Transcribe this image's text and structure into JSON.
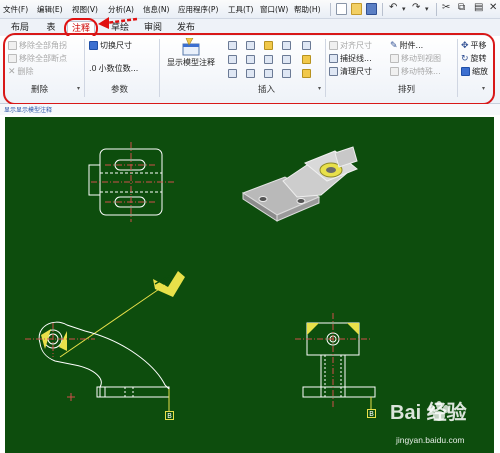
{
  "menubar": {
    "items": [
      "文件(F)",
      "编辑(E)",
      "视图(V)",
      "分析(A)",
      "信息(N)",
      "应用程序(P)",
      "工具(T)",
      "窗口(W)",
      "帮助(H)"
    ]
  },
  "tabs": [
    "布局",
    "表",
    "注释",
    "草绘",
    "审阅",
    "发布"
  ],
  "active_tab": "注释",
  "ribbon": {
    "delete_group": {
      "label": "删除",
      "items": [
        "移除全部角拐",
        "移除全部断点",
        "删除"
      ]
    },
    "params_group": {
      "label": "参数",
      "items": [
        "切换尺寸",
        "小数位数..."
      ]
    },
    "insert_group": {
      "label": "插入",
      "big_button": "显示模型注释"
    },
    "arrange_group": {
      "label": "排列",
      "items": [
        "对齐尺寸",
        "捕捉线...",
        "清理尺寸",
        "附件...",
        "移动到视图",
        "移动特殊...",
        "平移",
        "旋转",
        "缩放"
      ]
    }
  },
  "status_text": "显示显示模型注释",
  "drawing": {
    "datum_labels": [
      "B",
      "B"
    ]
  },
  "watermark": {
    "brand": "Bai 经验",
    "url": "jingyan.baidu.com"
  },
  "colors": {
    "canvas_bg": "#0d4d0d",
    "highlight_red": "#e01010",
    "drawing_lines": "#ffffff",
    "hatch_yellow": "#e8e04a",
    "centerline_red": "#d0504a"
  }
}
